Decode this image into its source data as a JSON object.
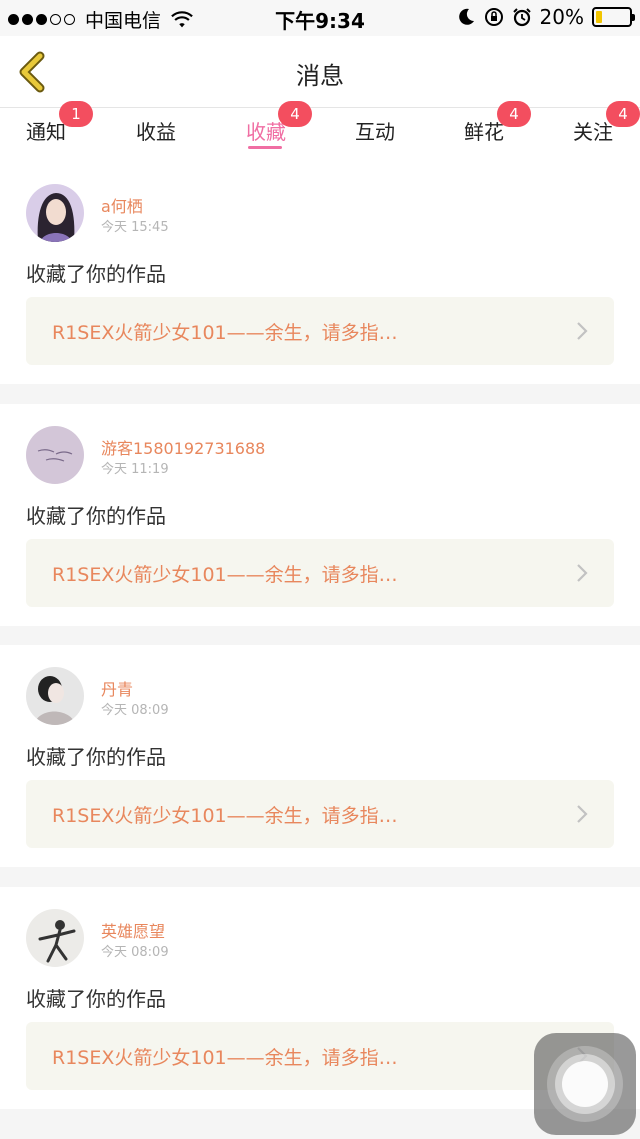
{
  "status_bar": {
    "carrier": "中国电信",
    "time": "下午9:34",
    "battery": "20%",
    "battery_level": 0.2
  },
  "nav": {
    "title": "消息"
  },
  "tabs": [
    {
      "label": "通知",
      "badge": "1"
    },
    {
      "label": "收益",
      "badge": ""
    },
    {
      "label": "收藏",
      "badge": "4",
      "active": true
    },
    {
      "label": "互动",
      "badge": ""
    },
    {
      "label": "鲜花",
      "badge": "4"
    },
    {
      "label": "关注",
      "badge": "4"
    }
  ],
  "items": [
    {
      "user": "a何栖",
      "time": "今天 15:45",
      "action": "收藏了你的作品",
      "work": "R1SEX火箭少女101——余生，请多指…"
    },
    {
      "user": "游客1580192731688",
      "time": "今天 11:19",
      "action": "收藏了你的作品",
      "work": "R1SEX火箭少女101——余生，请多指…"
    },
    {
      "user": "丹青",
      "time": "今天 08:09",
      "action": "收藏了你的作品",
      "work": "R1SEX火箭少女101——余生，请多指…"
    },
    {
      "user": "英雄愿望",
      "time": "今天 08:09",
      "action": "收藏了你的作品",
      "work": "R1SEX火箭少女101——余生，请多指…"
    }
  ],
  "colors": {
    "accent": "#f06ea3",
    "badge": "#f34e5f",
    "link": "#e8875d",
    "back_arrow": "#e8c93a"
  }
}
